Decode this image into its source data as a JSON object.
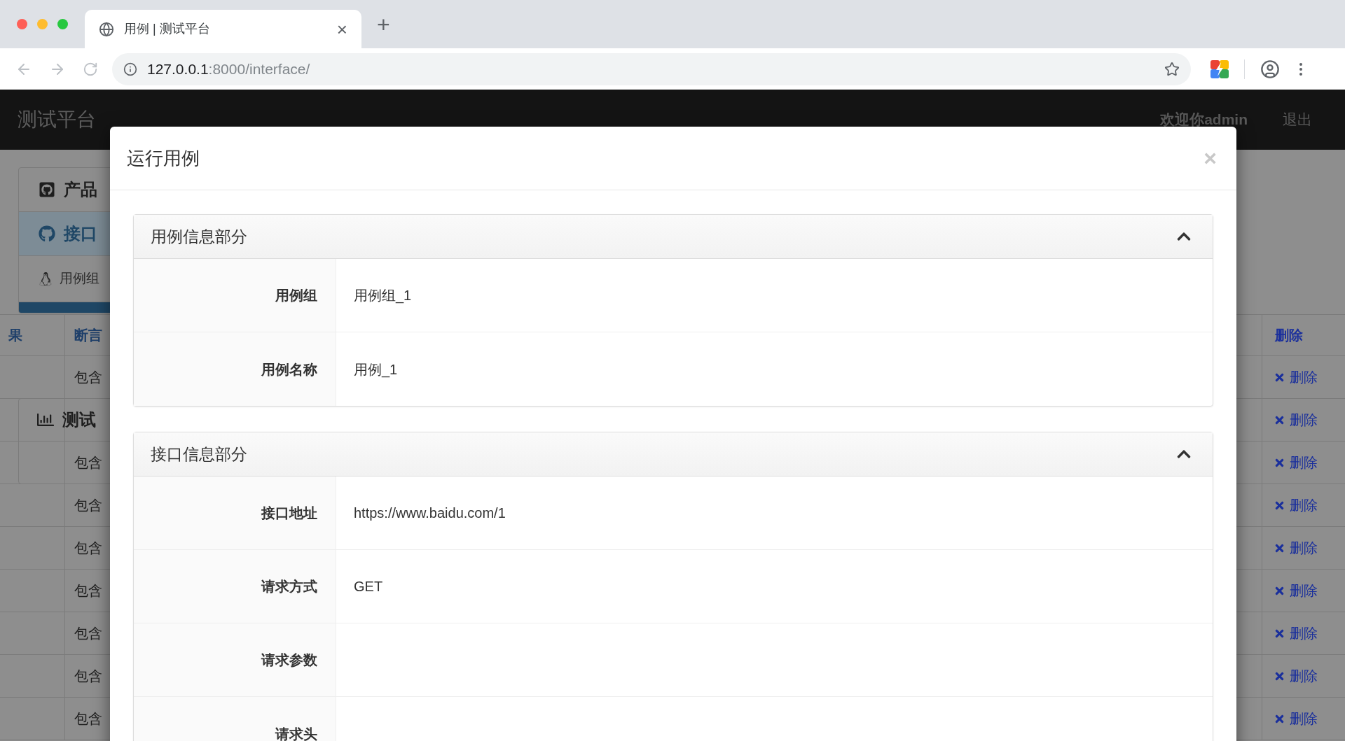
{
  "browser": {
    "tab": {
      "title": "用例 | 测试平台",
      "close": "×"
    },
    "new_tab": "+",
    "url": {
      "host": "127.0.0.1",
      "path": ":8000/interface/"
    }
  },
  "navbar": {
    "brand": "测试平台",
    "welcome": "欢迎你admin",
    "logout": "退出"
  },
  "sidebar": {
    "items": [
      {
        "label": "产品",
        "kind": "github-square",
        "selected": false
      },
      {
        "label": "接口",
        "kind": "github",
        "selected": true,
        "children": [
          {
            "label": "用例组",
            "kind": "linux"
          }
        ]
      },
      {
        "label": "测试",
        "kind": "chart",
        "selected": false
      }
    ]
  },
  "table": {
    "columns": [
      "果",
      "断言",
      "删除"
    ],
    "rows": [
      {
        "assert": "包含",
        "action": "删除"
      },
      {
        "action": "删除"
      },
      {
        "assert": "包含",
        "action": "删除"
      },
      {
        "assert": "包含",
        "action": "删除"
      },
      {
        "assert": "包含",
        "action": "删除"
      },
      {
        "assert": "包含",
        "action": "删除"
      },
      {
        "assert": "包含",
        "action": "删除"
      },
      {
        "assert": "包含",
        "action": "删除"
      },
      {
        "assert": "包含",
        "action": "删除"
      }
    ]
  },
  "modal": {
    "title": "运行用例",
    "close": "×",
    "sections": [
      {
        "title": "用例信息部分",
        "expanded": true,
        "fields": [
          {
            "label": "用例组",
            "value": "用例组_1"
          },
          {
            "label": "用例名称",
            "value": "用例_1"
          }
        ]
      },
      {
        "title": "接口信息部分",
        "expanded": true,
        "fields": [
          {
            "label": "接口地址",
            "value": "https://www.baidu.com/1"
          },
          {
            "label": "请求方式",
            "value": "GET"
          },
          {
            "label": "请求参数"
          },
          {
            "label": "请求头"
          }
        ]
      }
    ]
  }
}
